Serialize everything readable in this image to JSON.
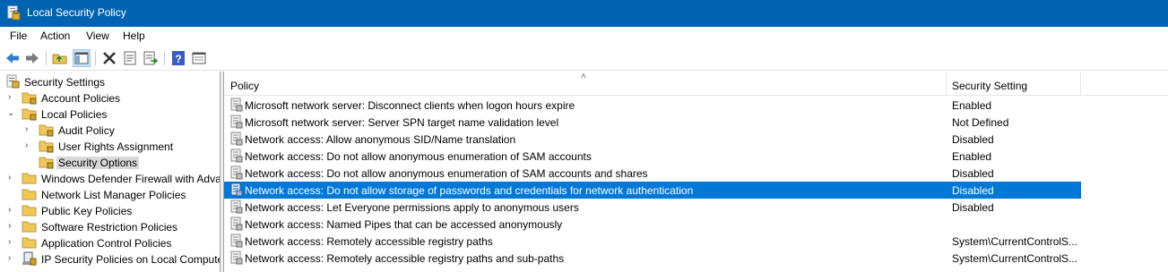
{
  "window": {
    "title": "Local Security Policy"
  },
  "menu": [
    "File",
    "Action",
    "View",
    "Help"
  ],
  "toolbar": {
    "buttons": [
      "back-icon",
      "forward-icon",
      "up-folder-icon",
      "show-hide-tree-icon",
      "delete-icon",
      "properties-icon",
      "export-list-icon",
      "help-icon",
      "view-icon"
    ]
  },
  "tree": {
    "root": "Security Settings",
    "items": [
      {
        "label": "Account Policies"
      },
      {
        "label": "Local Policies"
      },
      {
        "label": "Audit Policy"
      },
      {
        "label": "User Rights Assignment"
      },
      {
        "label": "Security Options"
      },
      {
        "label": "Windows Defender Firewall with Adva"
      },
      {
        "label": "Network List Manager Policies"
      },
      {
        "label": "Public Key Policies"
      },
      {
        "label": "Software Restriction Policies"
      },
      {
        "label": "Application Control Policies"
      },
      {
        "label": "IP Security Policies on Local Compute"
      }
    ]
  },
  "list": {
    "columns": {
      "policy": "Policy",
      "setting": "Security Setting"
    },
    "rows": [
      {
        "policy": "Microsoft network server: Disconnect clients when logon hours expire",
        "setting": "Enabled"
      },
      {
        "policy": "Microsoft network server: Server SPN target name validation level",
        "setting": "Not Defined"
      },
      {
        "policy": "Network access: Allow anonymous SID/Name translation",
        "setting": "Disabled"
      },
      {
        "policy": "Network access: Do not allow anonymous enumeration of SAM accounts",
        "setting": "Enabled"
      },
      {
        "policy": "Network access: Do not allow anonymous enumeration of SAM accounts and shares",
        "setting": "Disabled"
      },
      {
        "policy": "Network access: Do not allow storage of passwords and credentials for network authentication",
        "setting": "Disabled",
        "selected": true
      },
      {
        "policy": "Network access: Let Everyone permissions apply to anonymous users",
        "setting": "Disabled"
      },
      {
        "policy": "Network access: Named Pipes that can be accessed anonymously",
        "setting": ""
      },
      {
        "policy": "Network access: Remotely accessible registry paths",
        "setting": "System\\CurrentControlS..."
      },
      {
        "policy": "Network access: Remotely accessible registry paths and sub-paths",
        "setting": "System\\CurrentControlS..."
      }
    ]
  },
  "colors": {
    "titlebar": "#0063b1",
    "selection": "#0078d7",
    "tree_selection": "#d9d9d9"
  }
}
